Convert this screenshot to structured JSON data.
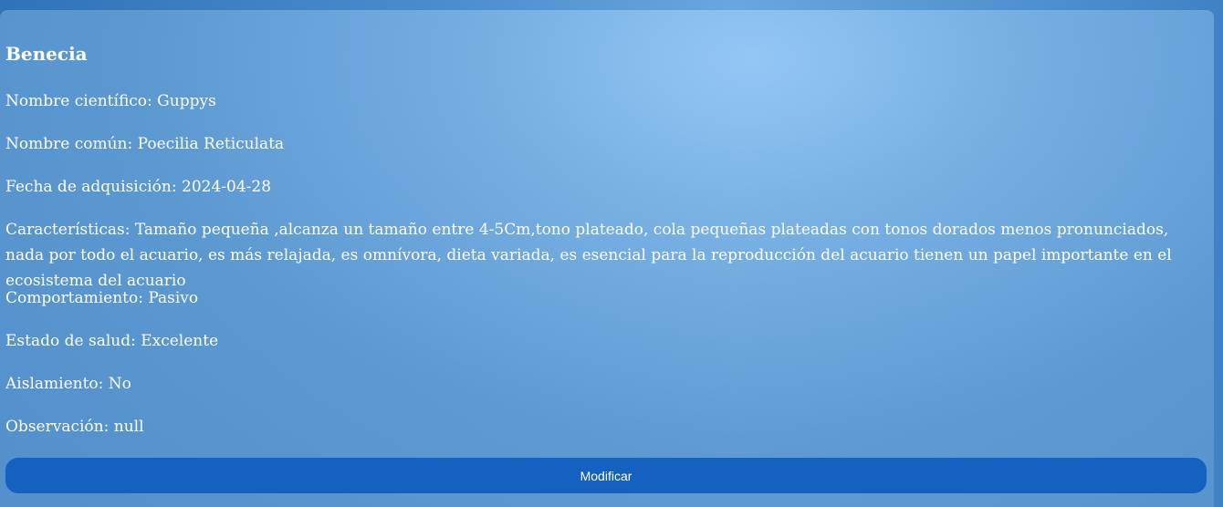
{
  "card": {
    "title": "Benecia",
    "fields": {
      "nombre_cientifico": "Nombre científico: Guppys",
      "nombre_comun": "Nombre común: Poecilia Reticulata",
      "fecha": "Fecha de adquisición: 2024-04-28",
      "caracteristicas": "Características: Tamaño pequeña ,alcanza un tamaño entre 4-5Cm,tono plateado, cola pequeñas plateadas con tonos dorados menos pronunciados, nada por todo el acuario, es más relajada, es omnívora, dieta variada, es esencial para la reproducción del acuario tienen un papel importante en el ecosistema del acuario",
      "comportamiento": "Comportamiento: Pasivo",
      "estado_salud": "Estado de salud: Excelente",
      "aislamiento": "Aislamiento: No",
      "observacion": "Observación: null"
    },
    "button_label": "Modificar"
  },
  "colors": {
    "button": "#1561c0",
    "text": "#ffffff"
  }
}
